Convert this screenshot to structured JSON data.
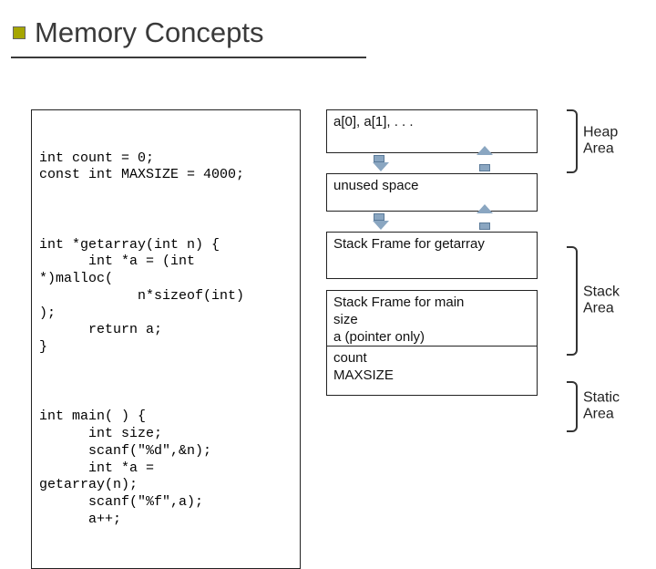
{
  "title": "Memory Concepts",
  "code": {
    "block1_l1": "int count = 0;",
    "block1_l2": "const int MAXSIZE = 4000;",
    "block2_l1": "int *getarray(int n) {",
    "block2_l2": "      int *a = (int",
    "block2_l3": "*)malloc(",
    "block2_l4": "            n*sizeof(int)",
    "block2_l5": ");",
    "block2_l6": "      return a;",
    "block2_l7": "}",
    "block3_l1": "int main( ) {",
    "block3_l2": "      int size;",
    "block3_l3": "      scanf(\"%d\",&n);",
    "block3_l4": "      int *a =",
    "block3_l5": "getarray(n);",
    "block3_l6": "      scanf(\"%f\",a);",
    "block3_l7": "      a++;"
  },
  "memory": {
    "heap_items": "a[0], a[1], . . .",
    "unused": "unused space",
    "stack_frame_getarray": "Stack Frame for getarray",
    "stack_frame_main_l1": "Stack Frame for main",
    "stack_frame_main_l2": "size",
    "stack_frame_main_l3": "a (pointer only)",
    "static_l1": "count",
    "static_l2": "MAXSIZE"
  },
  "labels": {
    "heap_l1": "Heap",
    "heap_l2": "Area",
    "stack_l1": "Stack",
    "stack_l2": "Area",
    "static_l1": "Static",
    "static_l2": "Area"
  }
}
